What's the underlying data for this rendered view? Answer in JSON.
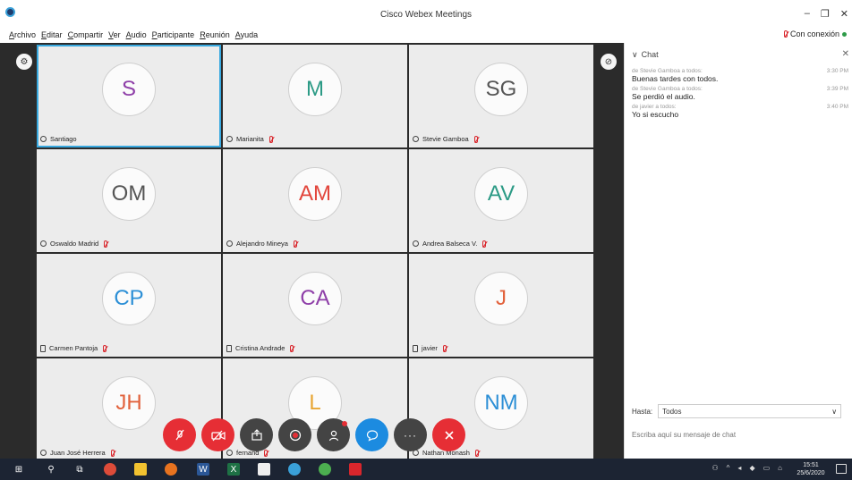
{
  "window": {
    "title": "Cisco Webex Meetings",
    "minimize": "–",
    "maximize": "❐",
    "close": "✕"
  },
  "menu": {
    "items": [
      "Archivo",
      "Editar",
      "Compartir",
      "Ver",
      "Audio",
      "Participante",
      "Reunión",
      "Ayuda"
    ],
    "status": "Con conexión"
  },
  "participants": [
    {
      "initials": "S",
      "name": "Santiago",
      "color": "#8e3ea8",
      "muted": false,
      "device": "computer",
      "active": true
    },
    {
      "initials": "M",
      "name": "Marianita",
      "color": "#2b9a85",
      "muted": true,
      "device": "computer",
      "active": false
    },
    {
      "initials": "SG",
      "name": "Stevie Gamboa",
      "color": "#555555",
      "muted": true,
      "device": "computer",
      "active": false
    },
    {
      "initials": "OM",
      "name": "Oswaldo Madrid",
      "color": "#555555",
      "muted": true,
      "device": "computer",
      "active": false
    },
    {
      "initials": "AM",
      "name": "Alejandro Mineya",
      "color": "#e2463c",
      "muted": true,
      "device": "computer",
      "active": false
    },
    {
      "initials": "AV",
      "name": "Andrea Balseca V.",
      "color": "#2b9a85",
      "muted": true,
      "device": "computer",
      "active": false
    },
    {
      "initials": "CP",
      "name": "Carmen Pantoja",
      "color": "#2c8fd6",
      "muted": true,
      "device": "phone",
      "active": false
    },
    {
      "initials": "CA",
      "name": "Cristina Andrade",
      "color": "#8e3ea8",
      "muted": true,
      "device": "phone",
      "active": false
    },
    {
      "initials": "J",
      "name": "javier",
      "color": "#e2623c",
      "muted": true,
      "device": "phone",
      "active": false
    },
    {
      "initials": "JH",
      "name": "Juan José Herrera",
      "color": "#e2623c",
      "muted": true,
      "device": "computer",
      "active": false
    },
    {
      "initials": "L",
      "name": "fernand",
      "color": "#e8a634",
      "muted": true,
      "device": "computer",
      "active": false
    },
    {
      "initials": "NM",
      "name": "Nathan Monash",
      "color": "#2c8fd6",
      "muted": true,
      "device": "computer",
      "active": false
    }
  ],
  "chat": {
    "title": "Chat",
    "messages": [
      {
        "from": "de Stevie Gamboa a todos:",
        "time": "3:30 PM",
        "text": "Buenas tardes con todos."
      },
      {
        "from": "de Stevie Gamboa a todos:",
        "time": "3:39 PM",
        "text": "Se perdió el audio."
      },
      {
        "from": "de javier a todos:",
        "time": "3:40 PM",
        "text": "Yo si escucho"
      }
    ],
    "to_label": "Hasta:",
    "to_value": "Todos",
    "input_placeholder": "Escriba aquí su mensaje de chat"
  },
  "taskbar": {
    "time": "15:51",
    "date": "25/6/2020"
  },
  "colors": {
    "accent": "#38a9e0",
    "danger": "#e62e35",
    "chat_blue": "#1c8be0",
    "dark_bg": "#2b2b2b"
  }
}
